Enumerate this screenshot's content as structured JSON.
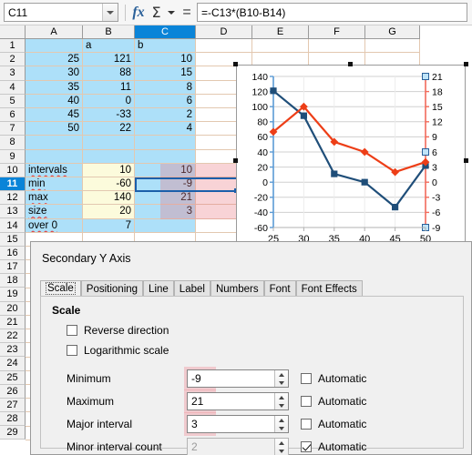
{
  "formula_bar": {
    "name_box_value": "C11",
    "fx_icon": "function-icon",
    "sum_icon": "sum-icon",
    "dropdown_icon": "chevron-down-icon",
    "equals_icon": "equals-icon",
    "formula_value": "=-C13*(B10-B14)"
  },
  "sheet": {
    "columns": [
      "A",
      "B",
      "C",
      "D",
      "E",
      "F",
      "G"
    ],
    "selected_column": "C",
    "selected_row": "11",
    "active_cell": "C11",
    "rows": [
      {
        "n": "1",
        "a": "",
        "b": "a",
        "c": "b"
      },
      {
        "n": "2",
        "a": "25",
        "b": "121",
        "c": "10"
      },
      {
        "n": "3",
        "a": "30",
        "b": "88",
        "c": "15"
      },
      {
        "n": "4",
        "a": "35",
        "b": "11",
        "c": "8"
      },
      {
        "n": "5",
        "a": "40",
        "b": "0",
        "c": "6"
      },
      {
        "n": "6",
        "a": "45",
        "b": "-33",
        "c": "2"
      },
      {
        "n": "7",
        "a": "50",
        "b": "22",
        "c": "4"
      },
      {
        "n": "8",
        "a": "",
        "b": "",
        "c": ""
      },
      {
        "n": "9",
        "a": "",
        "b": "",
        "c": ""
      },
      {
        "n": "10",
        "a": "intervals",
        "b": "10",
        "c": "10"
      },
      {
        "n": "11",
        "a": "min",
        "b": "-60",
        "c": "-9"
      },
      {
        "n": "12",
        "a": "max",
        "b": "140",
        "c": "21"
      },
      {
        "n": "13",
        "a": "size",
        "b": "20",
        "c": "3"
      },
      {
        "n": "14",
        "a": "over 0",
        "b": "7",
        "c": ""
      },
      {
        "n": "15",
        "a": "",
        "b": "",
        "c": ""
      },
      {
        "n": "16",
        "a": "",
        "b": "",
        "c": ""
      },
      {
        "n": "17",
        "a": "",
        "b": "",
        "c": ""
      },
      {
        "n": "18",
        "a": "",
        "b": "",
        "c": ""
      },
      {
        "n": "19",
        "a": "",
        "b": "",
        "c": ""
      },
      {
        "n": "20",
        "a": "",
        "b": "",
        "c": ""
      },
      {
        "n": "21",
        "a": "",
        "b": "",
        "c": ""
      },
      {
        "n": "22",
        "a": "",
        "b": "",
        "c": ""
      },
      {
        "n": "23",
        "a": "",
        "b": "",
        "c": ""
      },
      {
        "n": "24",
        "a": "",
        "b": "",
        "c": ""
      },
      {
        "n": "25",
        "a": "",
        "b": "",
        "c": ""
      },
      {
        "n": "26",
        "a": "",
        "b": "",
        "c": ""
      },
      {
        "n": "27",
        "a": "",
        "b": "",
        "c": ""
      },
      {
        "n": "28",
        "a": "",
        "b": "",
        "c": ""
      },
      {
        "n": "29",
        "a": "",
        "b": "",
        "c": ""
      }
    ]
  },
  "chart_data": {
    "type": "line",
    "title": "",
    "xlabel": "",
    "ylabel": "",
    "x": [
      25,
      30,
      35,
      40,
      45,
      50
    ],
    "xticks": [
      "25",
      "30",
      "35",
      "40",
      "45",
      "50"
    ],
    "series": [
      {
        "name": "a",
        "axis": "primary",
        "color": "#1f4e79",
        "marker": "square",
        "values": [
          121,
          88,
          11,
          0,
          -33,
          22
        ]
      },
      {
        "name": "b",
        "axis": "secondary",
        "color": "#ed3e17",
        "marker": "diamond",
        "values": [
          10,
          15,
          8,
          6,
          2,
          4
        ]
      }
    ],
    "primary_axis": {
      "ticks": [
        "140",
        "120",
        "100",
        "80",
        "60",
        "40",
        "20",
        "0",
        "-20",
        "-40",
        "-60"
      ],
      "min": -60,
      "max": 140,
      "interval": 20,
      "color": "#5b9bd5"
    },
    "secondary_axis": {
      "ticks": [
        "21",
        "18",
        "15",
        "12",
        "9",
        "6",
        "3",
        "0",
        "-3",
        "-6",
        "-9"
      ],
      "min": -9,
      "max": 21,
      "interval": 3,
      "color": "#f26b5b"
    },
    "grid": true,
    "legend": "none"
  },
  "dialog": {
    "title": "Secondary Y Axis",
    "tabs": [
      {
        "label": "Scale",
        "active": true
      },
      {
        "label": "Positioning",
        "active": false
      },
      {
        "label": "Line",
        "active": false
      },
      {
        "label": "Label",
        "active": false
      },
      {
        "label": "Numbers",
        "active": false
      },
      {
        "label": "Font",
        "active": false
      },
      {
        "label": "Font Effects",
        "active": false
      }
    ],
    "group_label": "Scale",
    "reverse_direction": {
      "label": "Reverse direction",
      "checked": false
    },
    "logarithmic_scale": {
      "label": "Logarithmic scale",
      "checked": false
    },
    "fields": [
      {
        "label": "Minimum",
        "value": "-9",
        "automatic_label": "Automatic",
        "automatic": false,
        "disabled": false,
        "highlight": true
      },
      {
        "label": "Maximum",
        "value": "21",
        "automatic_label": "Automatic",
        "automatic": false,
        "disabled": false,
        "highlight": true
      },
      {
        "label": "Major interval",
        "value": "3",
        "automatic_label": "Automatic",
        "automatic": false,
        "disabled": false,
        "highlight": true
      },
      {
        "label": "Minor interval count",
        "value": "2",
        "automatic_label": "Automatic",
        "automatic": true,
        "disabled": true,
        "highlight": false
      }
    ]
  }
}
